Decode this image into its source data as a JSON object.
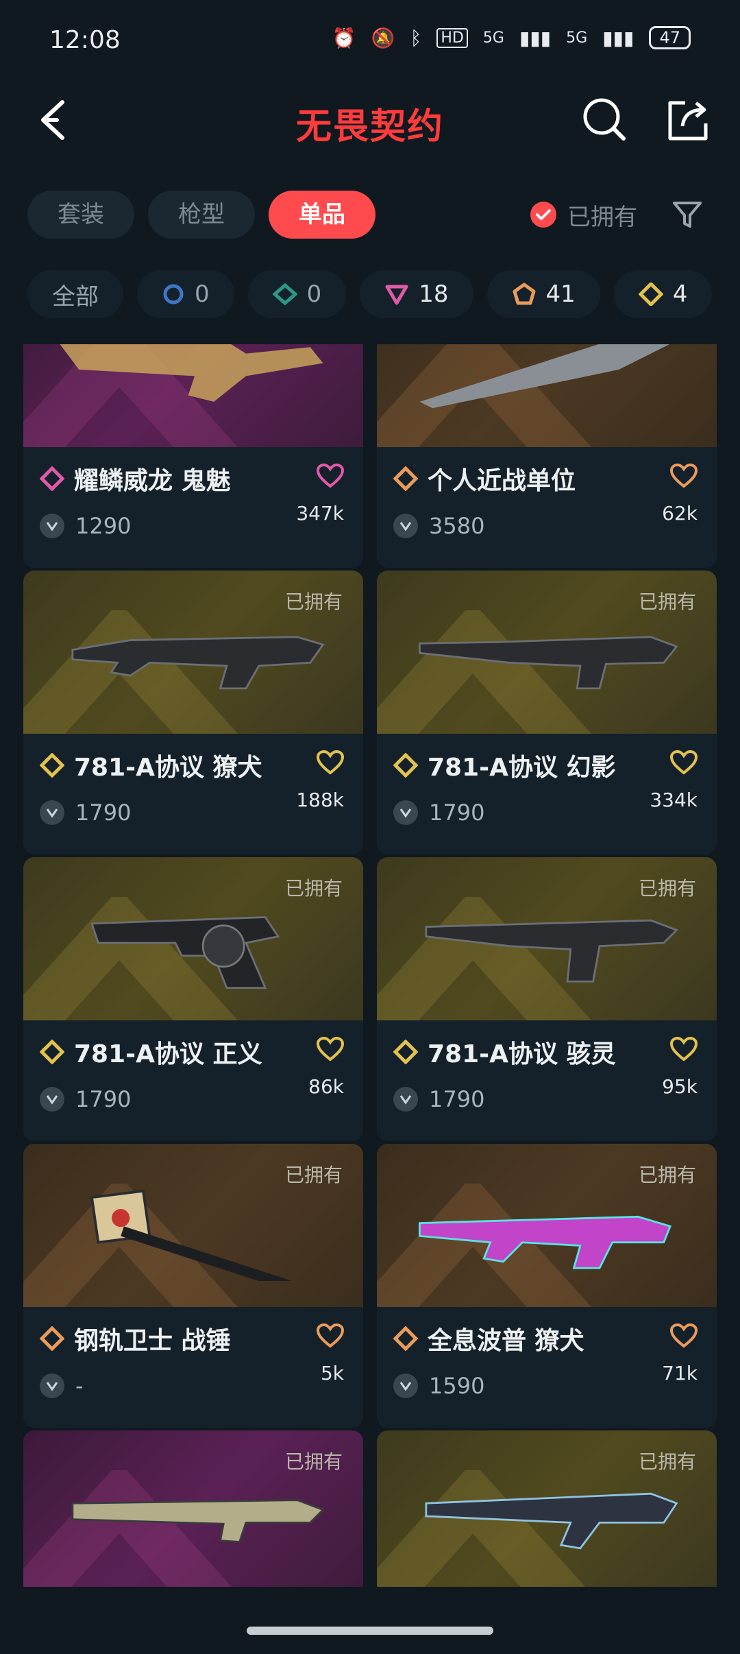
{
  "status_bar": {
    "time": "12:08",
    "network": "5G",
    "battery": "47"
  },
  "header": {
    "title": "无畏契约"
  },
  "tabs": [
    {
      "label": "套装",
      "active": false
    },
    {
      "label": "枪型",
      "active": false
    },
    {
      "label": "单品",
      "active": true
    }
  ],
  "owned_filter": {
    "label": "已拥有",
    "checked": true
  },
  "rarity_chips": [
    {
      "label": "全部"
    },
    {
      "tier": "select",
      "count": "0",
      "color": "#3b78c9"
    },
    {
      "tier": "deluxe",
      "count": "0",
      "color": "#2a9a86"
    },
    {
      "tier": "exclusive",
      "count": "18",
      "color": "#e05aa8"
    },
    {
      "tier": "ultra",
      "count": "41",
      "color": "#e99b5a"
    },
    {
      "tier": "premium",
      "count": "4",
      "color": "#e2c24d"
    }
  ],
  "cards": [
    {
      "name": "耀鳞威龙 鬼魅",
      "price": "1290",
      "likes": "347k",
      "owned_label": "",
      "tier_color": "#e05aa8",
      "heart_color": "#e05aa8",
      "bg": "purple"
    },
    {
      "name": "个人近战单位",
      "price": "3580",
      "likes": "62k",
      "owned_label": "",
      "tier_color": "#e99b5a",
      "heart_color": "#e99b5a",
      "bg": "bronze"
    },
    {
      "name": "781-A协议 獠犬",
      "price": "1790",
      "likes": "188k",
      "owned_label": "已拥有",
      "tier_color": "#e2c24d",
      "heart_color": "#e2c24d",
      "bg": "gold"
    },
    {
      "name": "781-A协议 幻影",
      "price": "1790",
      "likes": "334k",
      "owned_label": "已拥有",
      "tier_color": "#e2c24d",
      "heart_color": "#e2c24d",
      "bg": "gold"
    },
    {
      "name": "781-A协议 正义",
      "price": "1790",
      "likes": "86k",
      "owned_label": "已拥有",
      "tier_color": "#e2c24d",
      "heart_color": "#e2c24d",
      "bg": "gold"
    },
    {
      "name": "781-A协议 骇灵",
      "price": "1790",
      "likes": "95k",
      "owned_label": "已拥有",
      "tier_color": "#e2c24d",
      "heart_color": "#e2c24d",
      "bg": "gold"
    },
    {
      "name": "钢轨卫士 战锤",
      "price": "-",
      "likes": "5k",
      "owned_label": "已拥有",
      "tier_color": "#e99b5a",
      "heart_color": "#e99b5a",
      "bg": "bronze"
    },
    {
      "name": "全息波普 獠犬",
      "price": "1590",
      "likes": "71k",
      "owned_label": "已拥有",
      "tier_color": "#e99b5a",
      "heart_color": "#e99b5a",
      "bg": "bronze"
    },
    {
      "name": "",
      "price": "",
      "likes": "",
      "owned_label": "已拥有",
      "tier_color": "#e05aa8",
      "heart_color": "#e05aa8",
      "bg": "purple"
    },
    {
      "name": "",
      "price": "",
      "likes": "",
      "owned_label": "已拥有",
      "tier_color": "#e2c24d",
      "heart_color": "#e2c24d",
      "bg": "gold"
    }
  ]
}
